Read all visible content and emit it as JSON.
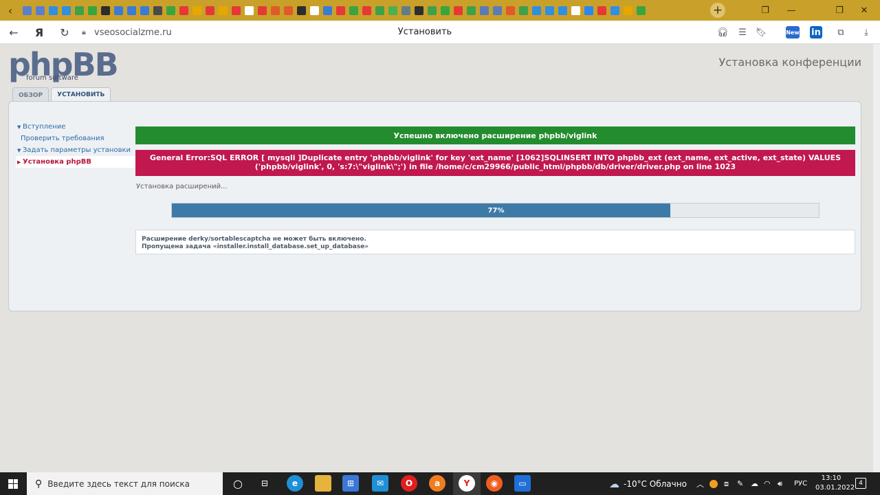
{
  "browser": {
    "tab_favicon_colors": [
      "#5a7fd0",
      "#5a7fd0",
      "#2f8fe0",
      "#2f8fe0",
      "#3fa04a",
      "#39a53e",
      "#2d2d2d",
      "#3a7bd5",
      "#3a7bd5",
      "#3a7bd5",
      "#4a4a4a",
      "#39a53e",
      "#e53935",
      "#e6a800",
      "#e53935",
      "#e6a800",
      "#e53935",
      "#ffffff",
      "#e53935",
      "#e05a2b",
      "#e05a2b",
      "#2d2d2d",
      "#ffffff",
      "#3a7bd5",
      "#e53935",
      "#39a53e",
      "#e53935",
      "#3fa04a",
      "#4caf50",
      "#607d8b",
      "#2d2d2d",
      "#3fa04a",
      "#39a53e",
      "#e53935",
      "#3fa04a",
      "#5b7bb8",
      "#5b7bb8",
      "#e05a2b",
      "#3fa04a",
      "#2f8fe0",
      "#2f8fe0",
      "#2f8fe0",
      "#ffffff",
      "#2787f5",
      "#e53935",
      "#2f8fe0",
      "#e6a800",
      "#39a53e"
    ],
    "new_tab_icon": "plus-icon",
    "url": "vseosocialzme.ru",
    "page_title": "Установить",
    "toolbar_new_badge": "New",
    "toolbar_linkedin": "in"
  },
  "header": {
    "logo_main": "phpBB",
    "logo_sub": "forum software",
    "conference_title": "Установка конференции"
  },
  "tabs": [
    {
      "label": "ОБЗОР",
      "active": false
    },
    {
      "label": "УСТАНОВИТЬ",
      "active": true
    }
  ],
  "sidebar": {
    "items": [
      {
        "label": "Вступление",
        "chevron": true,
        "active": false
      },
      {
        "label": "Проверить требования",
        "chevron": false,
        "active": false
      },
      {
        "label": "Задать параметры установки",
        "chevron": true,
        "active": false
      },
      {
        "label": "Установка phpBB",
        "chevron": true,
        "active": true
      }
    ]
  },
  "content": {
    "success_message": "Успешно включено расширение phpbb/viglink",
    "error_line1": "General Error:SQL ERROR [ mysqli ]Duplicate entry 'phpbb/viglink' for key 'ext_name' [1062]SQLINSERT INTO phpbb_ext (ext_name, ext_active, ext_state) VALUES",
    "error_line2": "('phpbb/viglink', 0, 's:7:\\\"viglink\\\";') in file /home/c/cm29966/public_html/phpbb/db/driver/driver.php on line 1023",
    "status": "Установка расширений...",
    "progress_label": "77%",
    "progress_fraction": 0.77,
    "log_line1": "Расширение derky/sortablescaptcha не может быть включено.",
    "log_line2": "Пропущена задача «installer.install_database.set_up_database»"
  },
  "colors": {
    "success": "#238c2e",
    "error": "#c0184f",
    "progress": "#3e7aa8",
    "link": "#2c6ba8",
    "active_link": "#b8173d"
  },
  "taskbar": {
    "search_placeholder": "Введите здесь текст для поиска",
    "weather": "-10°C Облачно",
    "language": "РУС",
    "time": "13:10",
    "date": "03.01.2022",
    "notification_count": "4"
  }
}
